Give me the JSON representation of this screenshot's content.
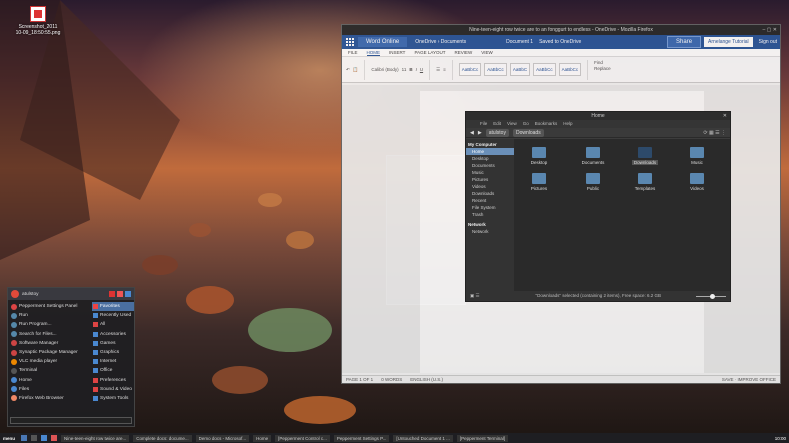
{
  "desktop": {
    "icon_label_1": "Screenshot_2011",
    "icon_label_2": "10-09_18:50:55.png"
  },
  "word": {
    "window_title": "Nine-teen-eight row twice are to an fonggurt to endless - OneDrive - Mozilla Firefox",
    "brand": "Word Online",
    "path": "OneDrive › Documents",
    "doc_name": "Document 1",
    "doc_state": "Saved to OneDrive",
    "share": "Share",
    "account": "Arnelange Tutorial",
    "signout": "Sign out",
    "tabs": [
      "FILE",
      "HOME",
      "INSERT",
      "PAGE LAYOUT",
      "REVIEW",
      "VIEW"
    ],
    "font": "Calibri (Body)",
    "font_size": "11",
    "styles": [
      "AaBbCc",
      "AaBbCc",
      "AaBbC",
      "AaBbCc",
      "AaBbCc"
    ],
    "style_names": [
      "Normal",
      "No Spacing",
      "Heading 1",
      "Heading 2",
      "Heading 3"
    ],
    "find": "Find",
    "replace": "Replace",
    "status_left": "PAGE 1 OF 1",
    "status_words": "0 WORDS",
    "status_lang": "ENGLISH (U.S.)",
    "status_right": "SAVE · IMPROVE OFFICE"
  },
  "nemo": {
    "title": "Home",
    "menu": [
      "File",
      "Edit",
      "View",
      "Go",
      "Bookmarks",
      "Help"
    ],
    "crumb_user": "atulstoy",
    "crumb_downloads": "Downloads",
    "side_heading_computer": "My Computer",
    "side_items": [
      "Home",
      "Desktop",
      "Documents",
      "Music",
      "Pictures",
      "Videos",
      "Downloads",
      "Recent",
      "File System",
      "Trash"
    ],
    "side_heading_network": "Network",
    "side_network": "Network",
    "files": [
      "Desktop",
      "Documents",
      "Downloads",
      "Music",
      "Pictures",
      "Public",
      "Templates",
      "Videos"
    ],
    "status": "\"Downloads\" selected (containing 2 items), Free space: 6.2 GB"
  },
  "startmenu": {
    "user": "atulstoy",
    "left_items": [
      "Pepperment Settings Panel",
      "Run",
      "Run Program...",
      "Search for Files...",
      "Software Manager",
      "Synaptic Package Manager",
      "VLC media player",
      "Terminal",
      "Home",
      "Files",
      "Firefox Web Browser"
    ],
    "right_items": [
      "Favorites",
      "Recently Used",
      "All",
      "Accessories",
      "Games",
      "Graphics",
      "Internet",
      "Office",
      "Preferences",
      "Sound & Video",
      "System Tools"
    ]
  },
  "taskbar": {
    "menu": "menu",
    "tasks": [
      "Nine-teen-eight row twice are...",
      "Complete docs: docume...",
      "Demo docs - Microsof...",
      "Home",
      "[Pepperment Control c...",
      "Pepperment Settings P...",
      "[Untouched Document 1 ...",
      "[Pepperment Terminal]"
    ],
    "clock": "10:00"
  }
}
